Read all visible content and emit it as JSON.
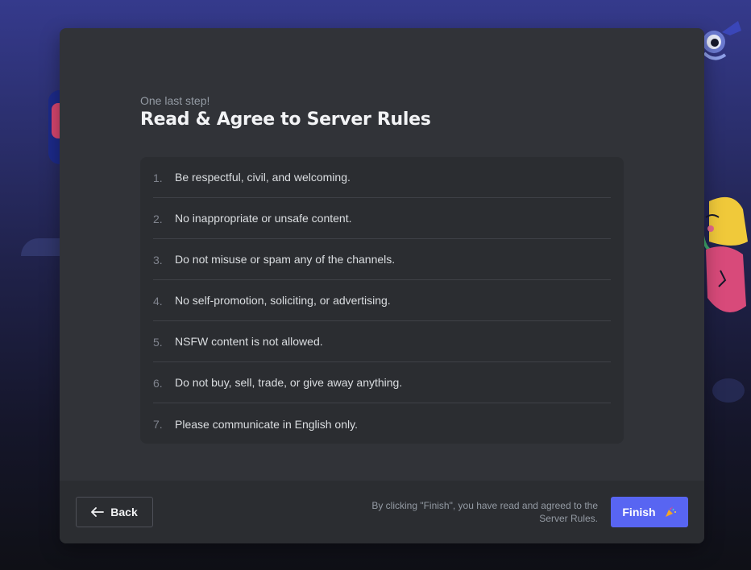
{
  "modal": {
    "step_label": "One last step!",
    "title": "Read & Agree to Server Rules"
  },
  "rules": [
    {
      "number": "1.",
      "text": "Be respectful, civil, and welcoming."
    },
    {
      "number": "2.",
      "text": "No inappropriate or unsafe content."
    },
    {
      "number": "3.",
      "text": "Do not misuse or spam any of the channels."
    },
    {
      "number": "4.",
      "text": "No self-promotion, soliciting, or advertising."
    },
    {
      "number": "5.",
      "text": "NSFW content is not allowed."
    },
    {
      "number": "6.",
      "text": "Do not buy, sell, trade, or give away anything."
    },
    {
      "number": "7.",
      "text": "Please communicate in English only."
    }
  ],
  "footer": {
    "back_label": "Back",
    "back_icon": "arrow-left-icon",
    "notice": "By clicking \"Finish\", you have read and agreed to the Server Rules.",
    "finish_label": "Finish",
    "finish_icon": "party-popper-icon",
    "finish_color": "#5865f2"
  }
}
